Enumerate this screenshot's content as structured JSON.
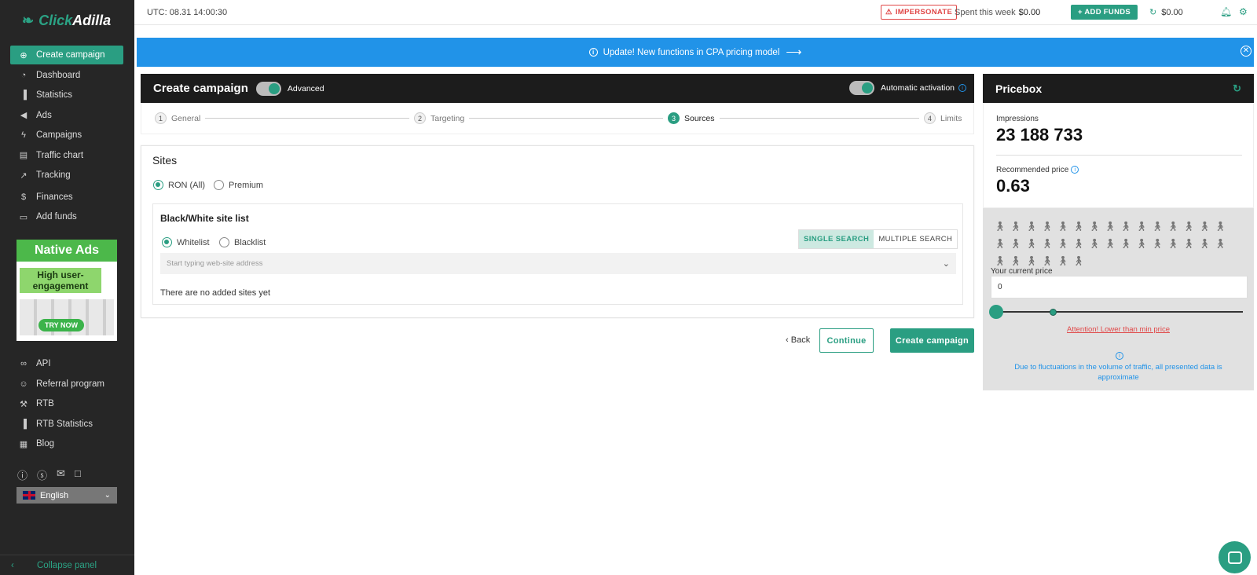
{
  "app": {
    "logo_a": "Click",
    "logo_b": "Adilla"
  },
  "sidebar": {
    "items": [
      {
        "label": "Create campaign",
        "icon": "plus-circle-icon"
      },
      {
        "label": "Dashboard",
        "icon": "pie-icon"
      },
      {
        "label": "Statistics",
        "icon": "bars-icon"
      },
      {
        "label": "Ads",
        "icon": "megaphone-icon"
      },
      {
        "label": "Campaigns",
        "icon": "bolt-icon"
      },
      {
        "label": "Traffic chart",
        "icon": "document-icon"
      },
      {
        "label": "Tracking",
        "icon": "trend-icon"
      },
      {
        "label": "Finances",
        "icon": "dollar-icon"
      },
      {
        "label": "Add funds",
        "icon": "card-icon"
      }
    ],
    "bottom_items": [
      {
        "label": "API",
        "icon": "link-icon"
      },
      {
        "label": "Referral program",
        "icon": "user-plus-icon"
      },
      {
        "label": "RTB",
        "icon": "gavel-icon"
      },
      {
        "label": "RTB Statistics",
        "icon": "bars-icon"
      },
      {
        "label": "Blog",
        "icon": "news-icon"
      }
    ],
    "banner": {
      "title": "Native Ads",
      "subtitle": "High user-engagement",
      "cta": "TRY NOW"
    },
    "language": "English",
    "collapse": "Collapse panel"
  },
  "topbar": {
    "utc": "UTC: 08.31 14:00:30",
    "impersonate": "IMPERSONATE",
    "spent_label": "Spent this week",
    "spent_value": "$0.00",
    "add_funds": "+ ADD FUNDS",
    "balance": "$0.00"
  },
  "info_banner": {
    "text": "Update! New functions in CPA pricing model"
  },
  "campaign": {
    "title": "Create campaign",
    "advanced": "Advanced",
    "auto_activation": "Automatic activation",
    "steps": [
      {
        "num": "1",
        "label": "General"
      },
      {
        "num": "2",
        "label": "Targeting"
      },
      {
        "num": "3",
        "label": "Sources"
      },
      {
        "num": "4",
        "label": "Limits"
      }
    ]
  },
  "sites": {
    "title": "Sites",
    "ron": "RON (All)",
    "premium": "Premium",
    "bw_title": "Black/White site list",
    "whitelist": "Whitelist",
    "blacklist": "Blacklist",
    "single_search": "SINGLE SEARCH",
    "multiple_search": "MULTIPLE SEARCH",
    "placeholder": "Start typing web-site address",
    "empty": "There are no added sites yet"
  },
  "actions": {
    "back": "Back",
    "continue": "Continue",
    "create": "Create campaign"
  },
  "pricebox": {
    "title": "Pricebox",
    "impressions_label": "Impressions",
    "impressions_value": "23 188 733",
    "rec_label": "Recommended price",
    "rec_value": "0.63",
    "current_label": "Your current price",
    "current_value": "0",
    "attention": "Attention! Lower than min price",
    "fluct": "Due to fluctuations in the volume of traffic, all presented data is approximate"
  },
  "colors": {
    "accent": "#2a9e82",
    "info": "#2193e8",
    "dark": "#1c1c1c",
    "sidebar": "#262626",
    "warning": "#e04848"
  }
}
